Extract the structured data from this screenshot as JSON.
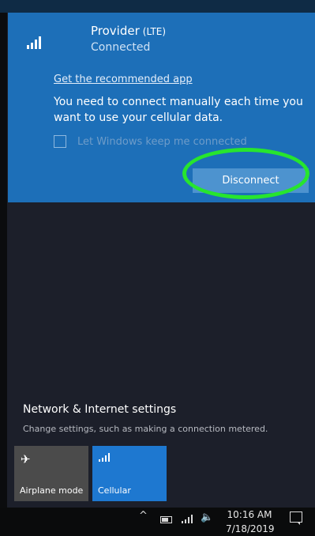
{
  "cellular": {
    "provider": "Provider",
    "network_type": "(LTE)",
    "status": "Connected",
    "app_link": "Get the recommended app",
    "manual_text": "You need to connect manually each time you want to use your cellular data.",
    "auto_connect_label": "Let Windows keep me connected",
    "auto_connect_checked": false,
    "disconnect_label": "Disconnect"
  },
  "settings": {
    "title": "Network & Internet settings",
    "subtitle": "Change settings, such as making a connection metered."
  },
  "quick_actions": [
    {
      "label": "Airplane mode",
      "icon": "airplane-icon",
      "active": false
    },
    {
      "label": "Cellular",
      "icon": "signal-icon",
      "active": true
    }
  ],
  "taskbar": {
    "time": "10:16 AM",
    "date": "7/18/2019",
    "chevron": "^",
    "volume_glyph": "🔈"
  },
  "colors": {
    "accent": "#1d6fb8",
    "highlight_ring": "#27e52e"
  }
}
